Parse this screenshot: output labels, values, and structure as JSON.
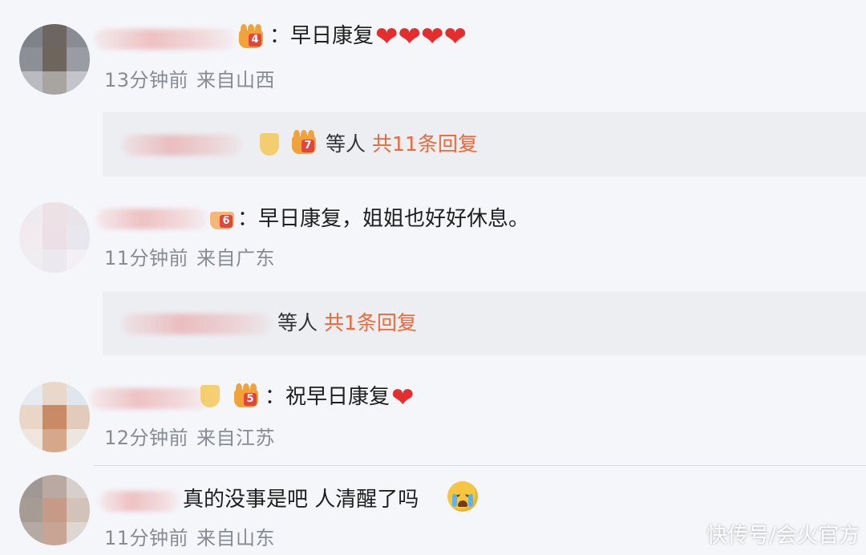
{
  "comments": [
    {
      "text": "：早日康复",
      "emoji_after": "❤❤❤❤",
      "badge_level": "4",
      "time": "13分钟前",
      "location": "来自山西",
      "reply": {
        "who_suffix": "等人",
        "count_label": "共11条回复",
        "badge_level": "7"
      }
    },
    {
      "text": "：早日康复，姐姐也好好休息。",
      "badge_level": "6",
      "time": "11分钟前",
      "location": "来自广东",
      "reply": {
        "who_suffix": "等人",
        "count_label": "共1条回复"
      }
    },
    {
      "text": "：祝早日康复",
      "emoji_after": "❤",
      "badge_level": "5",
      "time": "12分钟前",
      "location": "来自江苏"
    },
    {
      "text": "真的没事是吧 人清醒了吗",
      "emoji_after_icon": "crying-face-icon",
      "time": "11分钟前",
      "location": "来自山东"
    }
  ],
  "watermark": "快传号/会火官方",
  "colors": {
    "reply_count": "#e96a3a",
    "meta": "#868b94",
    "heart": "#e42d2d",
    "crown": "#f1a23a"
  }
}
